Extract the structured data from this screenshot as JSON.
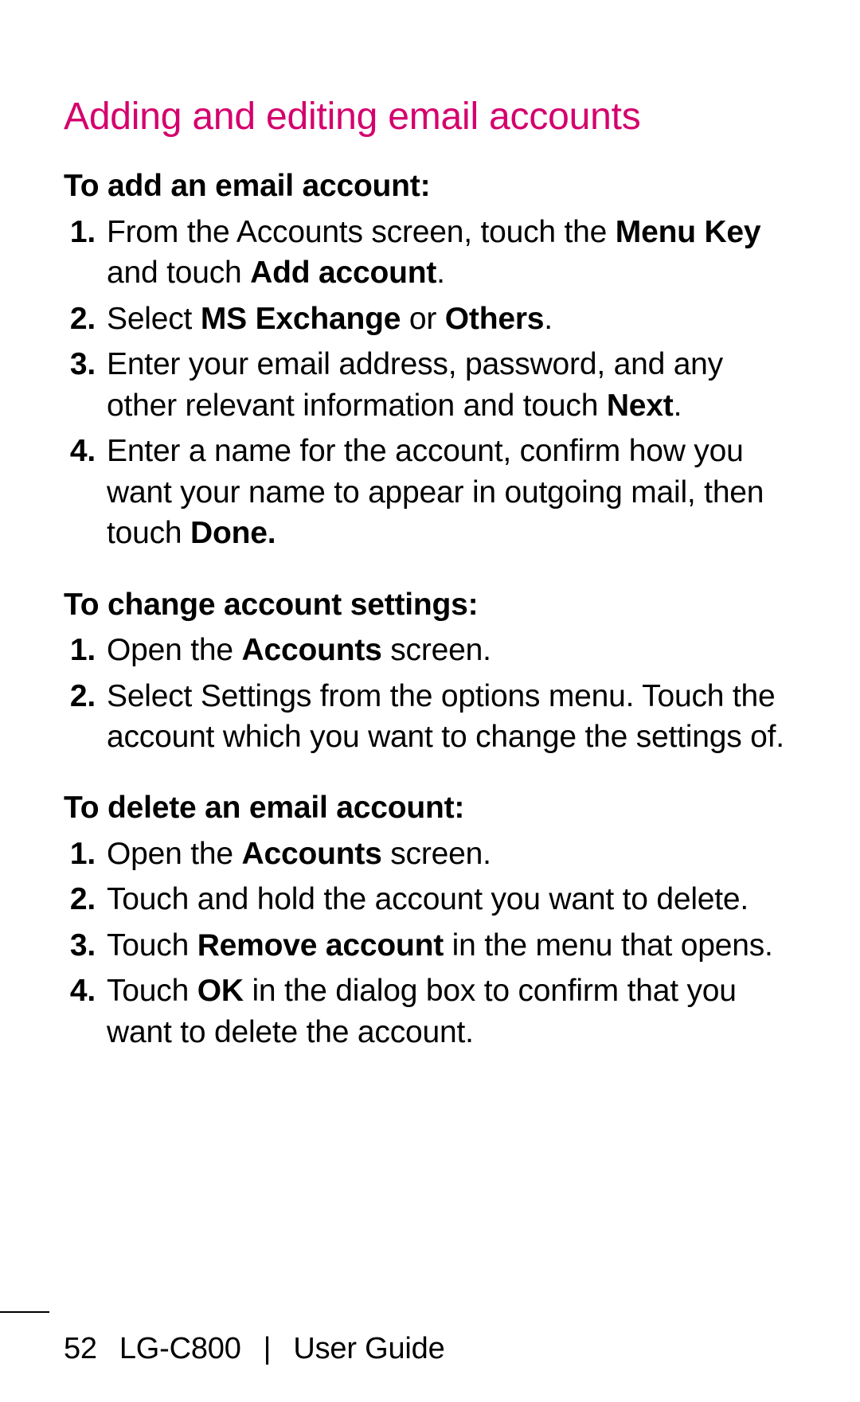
{
  "title": "Adding and editing email accounts",
  "sections": [
    {
      "heading": "To add an email account:",
      "items": [
        {
          "num": "1.",
          "pre": "From the Accounts screen, touch the ",
          "b1": "Menu Key",
          "mid": " and touch ",
          "b2": "Add account",
          "post": "."
        },
        {
          "num": "2.",
          "pre": "Select ",
          "b1": "MS Exchange",
          "mid": " or ",
          "b2": "Others",
          "post": "."
        },
        {
          "num": "3.",
          "pre": "Enter your email address, password, and any other relevant information and touch ",
          "b1": "Next",
          "mid": "",
          "b2": "",
          "post": "."
        },
        {
          "num": "4.",
          "pre": "Enter a name for the account, confirm how you want your name to appear in outgoing mail, then touch ",
          "b1": "Done.",
          "mid": "",
          "b2": "",
          "post": ""
        }
      ]
    },
    {
      "heading": "To change account settings:",
      "items": [
        {
          "num": "1.",
          "pre": "Open the ",
          "b1": "Accounts",
          "mid": " screen.",
          "b2": "",
          "post": ""
        },
        {
          "num": "2.",
          "pre": "Select Settings from the options menu. Touch the account which you want to  change the settings of.",
          "b1": "",
          "mid": "",
          "b2": "",
          "post": ""
        }
      ]
    },
    {
      "heading": "To delete an email account:",
      "items": [
        {
          "num": "1.",
          "pre": "Open the ",
          "b1": "Accounts",
          "mid": " screen.",
          "b2": "",
          "post": ""
        },
        {
          "num": "2.",
          "pre": "Touch and hold the account you want to delete.",
          "b1": "",
          "mid": "",
          "b2": "",
          "post": ""
        },
        {
          "num": "3.",
          "pre": "Touch ",
          "b1": "Remove account",
          "mid": " in the menu that opens.",
          "b2": "",
          "post": ""
        },
        {
          "num": "4.",
          "pre": "Touch ",
          "b1": "OK",
          "mid": " in the dialog box to confirm that you want to delete the account.",
          "b2": "",
          "post": ""
        }
      ]
    }
  ],
  "footer": {
    "page_number": "52",
    "model": "LG-C800",
    "separator": "|",
    "label": "User Guide"
  }
}
